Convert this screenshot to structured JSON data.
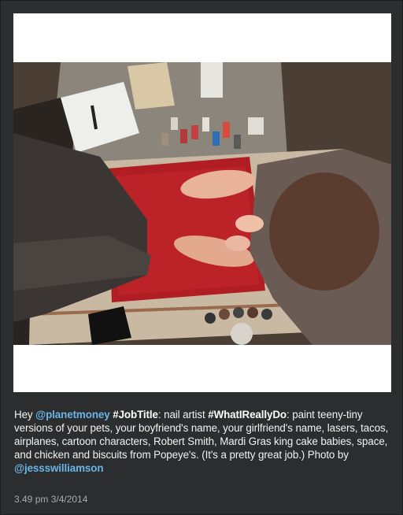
{
  "post": {
    "caption": {
      "greeting": "Hey",
      "mention_1": "@planetmoney",
      "hashtag_1": "#JobTitle",
      "text_1": ": nail artist",
      "hashtag_2": "#WhatIReallyDo",
      "text_2": ": paint teeny-tiny versions of your pets, your boyfriend's name, your girlfriend's name, lasers, tacos, airplanes, cartoon characters, Robert Smith, Mardi Gras king cake babies, space, and chicken and biscuits from Popeye's. (It's a pretty great job.) Photo by",
      "mention_2": "@jessswilliamson"
    },
    "timestamp": "3.49 pm 3/4/2014"
  },
  "colors": {
    "background": "#2b2d2e",
    "mention": "#6ab5e6",
    "text": "#f2f2f2",
    "meta": "#a9abad"
  }
}
